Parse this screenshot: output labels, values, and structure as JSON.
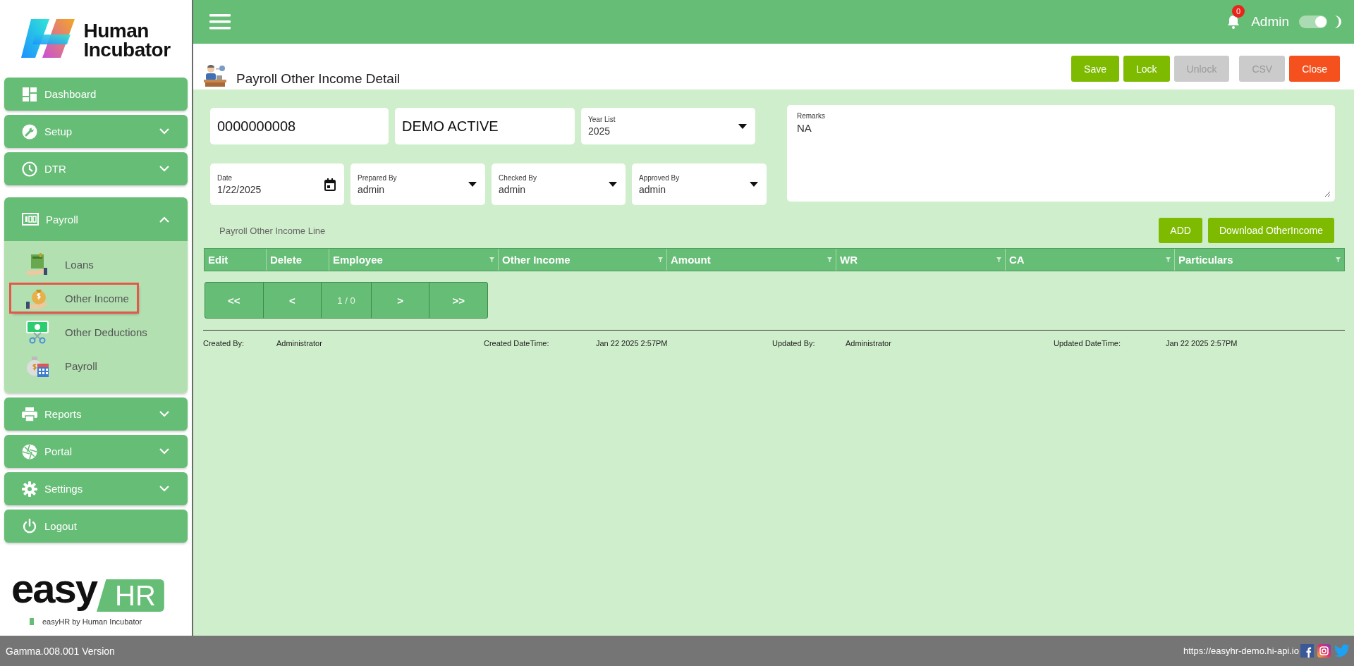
{
  "sidebar": {
    "brand": [
      "Human",
      "Incubator"
    ],
    "menu": [
      {
        "kind": "link",
        "label": "Dashboard"
      },
      {
        "kind": "group",
        "label": "Setup",
        "expanded": false
      },
      {
        "kind": "group",
        "label": "DTR",
        "expanded": false
      },
      {
        "kind": "group",
        "label": "Payroll",
        "expanded": true,
        "children": [
          {
            "label": "Loans",
            "selected": false
          },
          {
            "label": "Other Income",
            "selected": true
          },
          {
            "label": "Other Deductions",
            "selected": false
          },
          {
            "label": "Payroll",
            "selected": false
          }
        ]
      },
      {
        "kind": "group",
        "label": "Reports",
        "expanded": false
      },
      {
        "kind": "group",
        "label": "Portal",
        "expanded": false
      },
      {
        "kind": "group",
        "label": "Settings",
        "expanded": false
      },
      {
        "kind": "link",
        "label": "Logout"
      }
    ],
    "product_logo": {
      "word": "easy",
      "tag": "HR",
      "caption": "easyHR by Human Incubator"
    }
  },
  "topbar": {
    "notifications": "0",
    "user": "Admin",
    "dark_mode": {
      "on": true
    }
  },
  "page": {
    "title": "Payroll Other Income Detail",
    "buttons": [
      {
        "label": "Save",
        "kind": "primary",
        "disabled": false
      },
      {
        "label": "Lock",
        "kind": "primary",
        "disabled": false
      },
      {
        "label": "Unlock",
        "kind": "primary",
        "disabled": true
      },
      {
        "label": "CSV",
        "kind": "primary",
        "disabled": true
      },
      {
        "label": "Close",
        "kind": "danger",
        "disabled": false
      }
    ]
  },
  "form": {
    "row_1": [
      {
        "kind": "text",
        "value": "0000000008"
      },
      {
        "kind": "text",
        "value": "DEMO ACTIVE"
      },
      {
        "kind": "select",
        "label": "Year List",
        "value": "2025"
      }
    ],
    "row_2": [
      {
        "kind": "date",
        "label": "Date",
        "value": "1/22/2025"
      },
      {
        "kind": "select",
        "label": "Prepared By",
        "value": "admin"
      },
      {
        "kind": "select",
        "label": "Checked By",
        "value": "admin"
      },
      {
        "kind": "select",
        "label": "Approved By",
        "value": "admin"
      }
    ],
    "remarks": {
      "label": "Remarks",
      "value": "NA"
    }
  },
  "lines": {
    "title": "Payroll Other Income Line",
    "buttons": [
      "ADD",
      "Download OtherIncome"
    ],
    "columns": [
      {
        "label": "Edit",
        "filterable": false
      },
      {
        "label": "Delete",
        "filterable": false
      },
      {
        "label": "Employee",
        "filterable": true
      },
      {
        "label": "Other Income",
        "filterable": true
      },
      {
        "label": "Amount",
        "filterable": true
      },
      {
        "label": "WR",
        "filterable": true
      },
      {
        "label": "CA",
        "filterable": true
      },
      {
        "label": "Particulars",
        "filterable": true
      }
    ],
    "pager": [
      "<<",
      "<",
      "1 / 0",
      ">",
      ">>"
    ]
  },
  "audit": [
    {
      "label": "Created By:",
      "value": "Administrator"
    },
    {
      "label": "Created DateTime:",
      "value": "Jan 22 2025 2:57PM"
    },
    {
      "label": "Updated By:",
      "value": "Administrator"
    },
    {
      "label": "Updated DateTime:",
      "value": "Jan 22 2025 2:57PM"
    }
  ],
  "status_bar": {
    "version": "Gamma.008.001 Version",
    "url": "https://easyhr-demo.hi-api.io"
  }
}
